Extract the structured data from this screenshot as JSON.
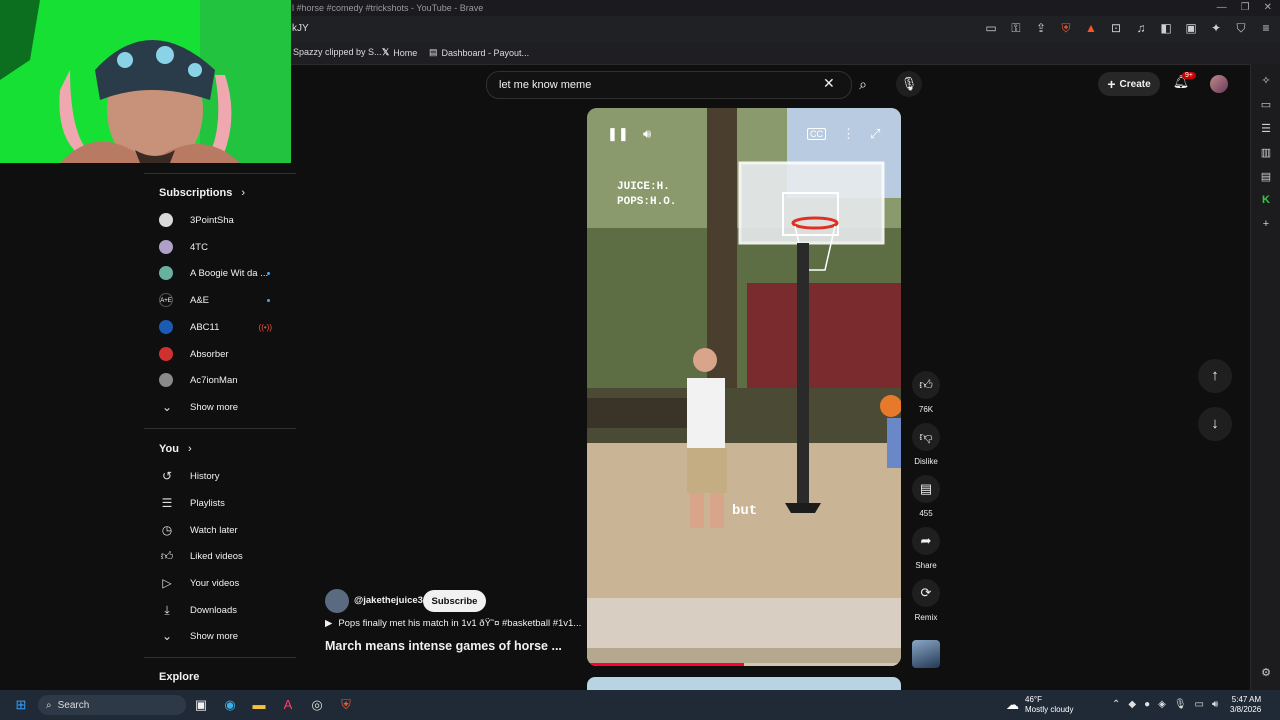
{
  "browser": {
    "window_title": "l #horse #comedy #trickshots - YouTube - Brave",
    "url_fragment": "kJY",
    "bookmarks": [
      "Spazzy clipped by S...",
      "Home",
      "Dashboard - Payout..."
    ]
  },
  "header": {
    "search_value": "let me know meme",
    "create_label": "Create",
    "notification_badge": "9+"
  },
  "sidebar": {
    "subscriptions_title": "Subscriptions",
    "subscriptions": [
      {
        "label": "3PointSha",
        "avatar_color": "#d9d9d9",
        "new": false
      },
      {
        "label": "4TC",
        "avatar_color": "#b0a0c8",
        "new": false
      },
      {
        "label": "A Boogie Wit da ...",
        "avatar_color": "#6ab0a0",
        "new": true
      },
      {
        "label": "A&E",
        "avatar_color": "#0f0f0f",
        "new": true
      },
      {
        "label": "ABC11",
        "avatar_color": "#1a5bb5",
        "new": false,
        "live": true
      },
      {
        "label": "Absorber",
        "avatar_color": "#d03030",
        "new": false
      },
      {
        "label": "Ac7ionMan",
        "avatar_color": "#8a8a8a",
        "new": false
      }
    ],
    "show_more_1": "Show more",
    "you_title": "You",
    "you_items": [
      {
        "label": "History",
        "icon": "history-icon"
      },
      {
        "label": "Playlists",
        "icon": "playlists-icon"
      },
      {
        "label": "Watch later",
        "icon": "watch-later-icon"
      },
      {
        "label": "Liked videos",
        "icon": "like-icon"
      },
      {
        "label": "Your videos",
        "icon": "your-videos-icon"
      },
      {
        "label": "Downloads",
        "icon": "download-icon"
      }
    ],
    "show_more_2": "Show more",
    "explore_title": "Explore"
  },
  "video": {
    "overlay_line1": "JUICE:H.",
    "overlay_line2": "POPS:H.O.",
    "caption": "but",
    "progress_fraction": 0.5,
    "channel": "@jakethejuice3",
    "subscribe_label": "Subscribe",
    "playlist_text": "Pops finally met his match in 1v1 ðŸ˜¤ #basketball #1v1...",
    "title": "March means intense games of horse ..."
  },
  "actions": {
    "likes": "76K",
    "dislike": "Dislike",
    "comments": "455",
    "share": "Share",
    "remix": "Remix"
  },
  "taskbar": {
    "search_label": "Search",
    "temperature": "46°F",
    "weather": "Mostly cloudy",
    "time": "5:47 AM",
    "date": "3/8/2026"
  },
  "colors": {
    "accent": "#ff0033",
    "webcam_bg": "#17e035",
    "subscribe_bg": "#f1f1f1"
  }
}
